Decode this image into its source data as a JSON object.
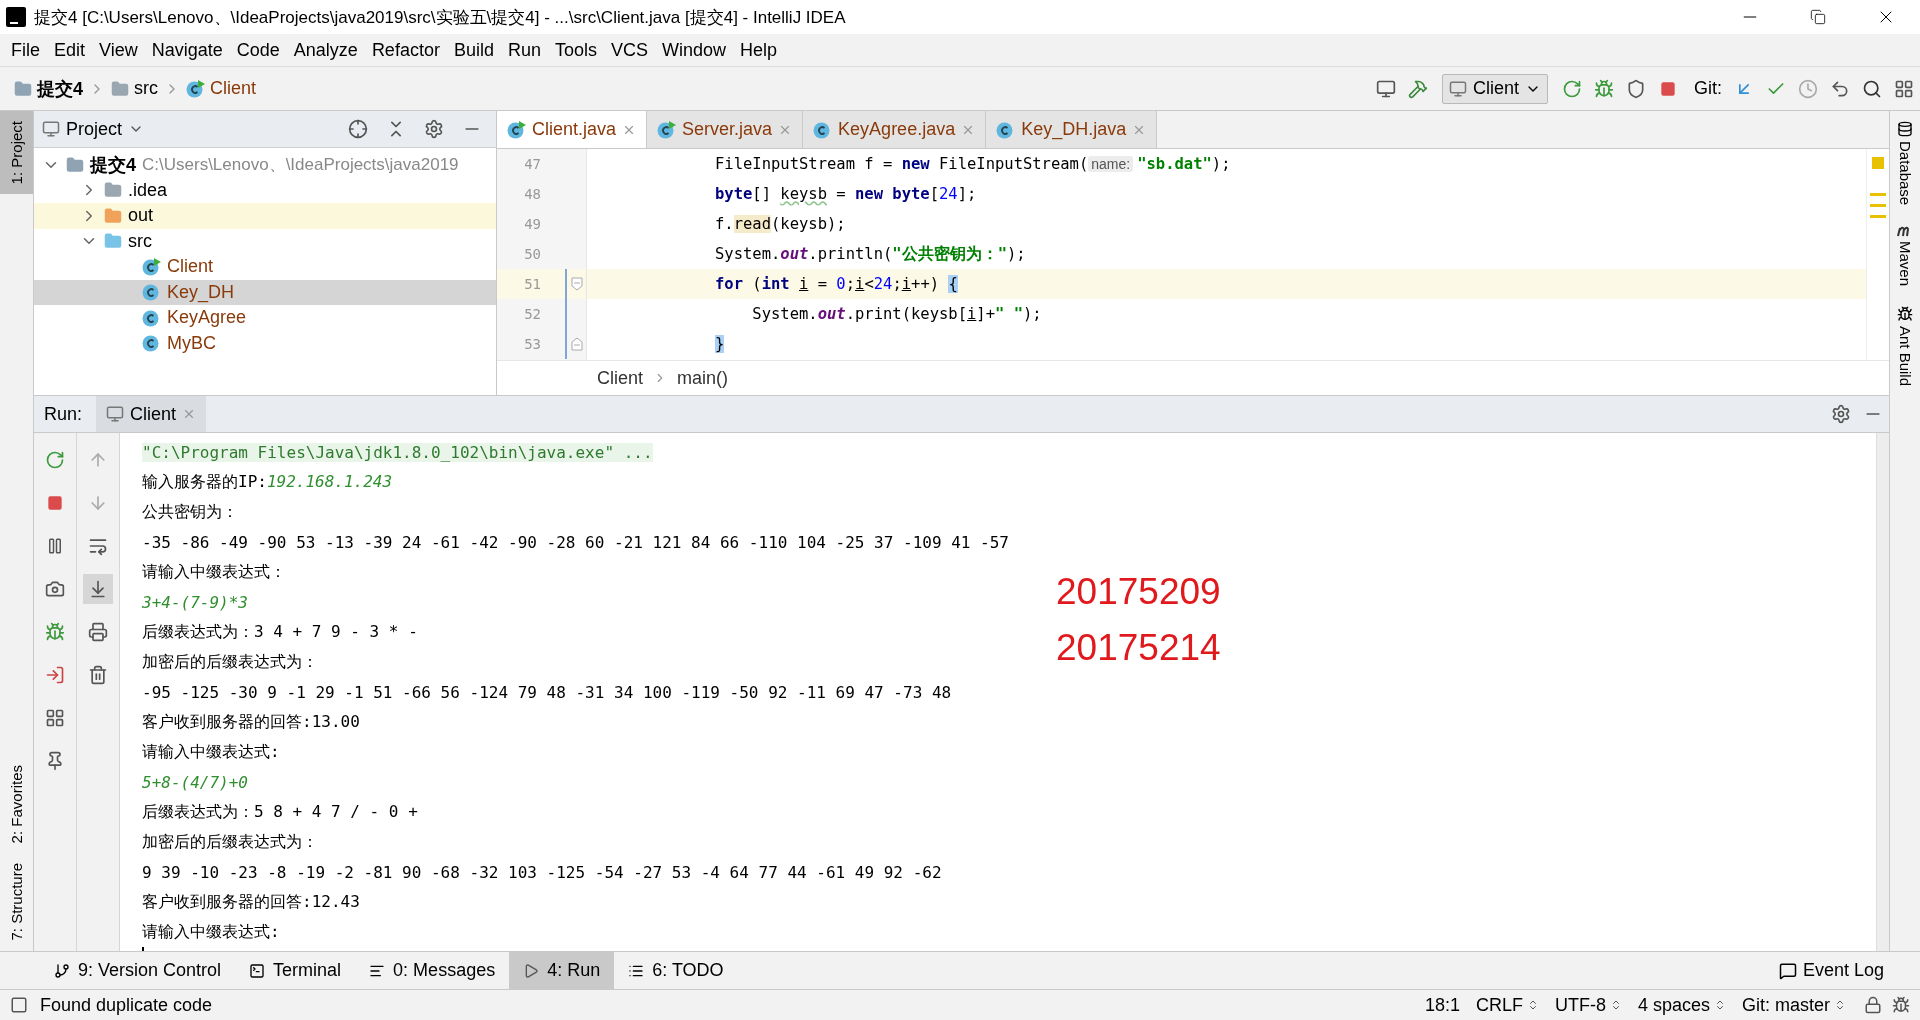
{
  "window": {
    "title": "提交4 [C:\\Users\\Lenovo、\\IdeaProjects\\java2019\\src\\实验五\\提交4] - ...\\src\\Client.java [提交4] - IntelliJ IDEA"
  },
  "menu": [
    "File",
    "Edit",
    "View",
    "Navigate",
    "Code",
    "Analyze",
    "Refactor",
    "Build",
    "Run",
    "Tools",
    "VCS",
    "Window",
    "Help"
  ],
  "breadcrumb": [
    {
      "label": "提交4",
      "kind": "module"
    },
    {
      "label": "src",
      "kind": "folder"
    },
    {
      "label": "Client",
      "kind": "runnable"
    }
  ],
  "toolbar": {
    "run_config": "Client",
    "git_label": "Git:"
  },
  "left_stripe": [
    {
      "label": "1: Project",
      "selected": true,
      "kind": "top"
    },
    {
      "label": "2: Favorites",
      "selected": false,
      "kind": "bottom"
    },
    {
      "label": "7: Structure",
      "selected": false,
      "kind": "bottom"
    }
  ],
  "right_stripe": [
    "Database",
    "Maven",
    "Ant Build"
  ],
  "project_panel": {
    "title": "Project",
    "tree": [
      {
        "label": "提交4",
        "path": "C:\\Users\\Lenovo、\\IdeaProjects\\java2019",
        "kind": "module",
        "expanded": true,
        "selected": false,
        "children": [
          {
            "label": ".idea",
            "kind": "folder",
            "expanded": false,
            "selected": false
          },
          {
            "label": "out",
            "kind": "excluded",
            "expanded": false,
            "selected": false
          },
          {
            "label": "src",
            "kind": "source",
            "expanded": true,
            "selected": false,
            "children": [
              {
                "label": "Client",
                "kind": "runnable",
                "selected": false
              },
              {
                "label": "Key_DH",
                "kind": "class",
                "selected": true
              },
              {
                "label": "KeyAgree",
                "kind": "class",
                "selected": false
              },
              {
                "label": "MyBC",
                "kind": "class",
                "selected": false
              }
            ]
          }
        ]
      }
    ]
  },
  "editor_tabs": [
    {
      "label": "Client.java",
      "kind": "runnable",
      "selected": true
    },
    {
      "label": "Server.java",
      "kind": "runnable",
      "selected": false
    },
    {
      "label": "KeyAgree.java",
      "kind": "class",
      "selected": false
    },
    {
      "label": "Key_DH.java",
      "kind": "class",
      "selected": false
    }
  ],
  "code_lines": [
    {
      "number": "47",
      "current": false,
      "changed": false,
      "segments": [
        {
          "kind": "plain",
          "text": "FileInputStream f = "
        },
        {
          "kind": "kw",
          "text": "new"
        },
        {
          "kind": "plain",
          "text": " FileInputStream("
        },
        {
          "kind": "hint",
          "text": "name:"
        },
        {
          "kind": "str",
          "text": "\"sb.dat\""
        },
        {
          "kind": "plain",
          "text": ");"
        }
      ]
    },
    {
      "number": "48",
      "current": false,
      "changed": false,
      "segments": [
        {
          "kind": "kw",
          "text": "byte"
        },
        {
          "kind": "plain",
          "text": "[] "
        },
        {
          "kind": "typo",
          "text": "keysb"
        },
        {
          "kind": "plain",
          "text": " = "
        },
        {
          "kind": "kw",
          "text": "new byte"
        },
        {
          "kind": "plain",
          "text": "["
        },
        {
          "kind": "num",
          "text": "24"
        },
        {
          "kind": "plain",
          "text": "];"
        }
      ]
    },
    {
      "number": "49",
      "current": false,
      "changed": false,
      "segments": [
        {
          "kind": "plain",
          "text": "f."
        },
        {
          "kind": "mark",
          "text": "read"
        },
        {
          "kind": "plain",
          "text": "(keysb);"
        }
      ]
    },
    {
      "number": "50",
      "current": false,
      "changed": false,
      "segments": [
        {
          "kind": "plain",
          "text": "System."
        },
        {
          "kind": "static",
          "text": "out"
        },
        {
          "kind": "plain",
          "text": ".println("
        },
        {
          "kind": "str",
          "text": "\"公共密钥为：\""
        },
        {
          "kind": "plain",
          "text": ");"
        }
      ]
    },
    {
      "number": "51",
      "current": true,
      "changed": true,
      "fold_start": true,
      "segments": [
        {
          "kind": "kw",
          "text": "for"
        },
        {
          "kind": "plain",
          "text": " ("
        },
        {
          "kind": "kw",
          "text": "int "
        },
        {
          "kind": "var",
          "text": "i"
        },
        {
          "kind": "plain",
          "text": " = "
        },
        {
          "kind": "num",
          "text": "0"
        },
        {
          "kind": "plain",
          "text": ";"
        },
        {
          "kind": "var",
          "text": "i"
        },
        {
          "kind": "plain",
          "text": "<"
        },
        {
          "kind": "num",
          "text": "24"
        },
        {
          "kind": "plain",
          "text": ";"
        },
        {
          "kind": "var",
          "text": "i"
        },
        {
          "kind": "plain",
          "text": "++) "
        },
        {
          "kind": "brace",
          "text": "{"
        }
      ]
    },
    {
      "number": "52",
      "current": false,
      "changed": true,
      "segments": [
        {
          "kind": "plain",
          "text": "    System."
        },
        {
          "kind": "static",
          "text": "out"
        },
        {
          "kind": "plain",
          "text": ".print(keysb["
        },
        {
          "kind": "var",
          "text": "i"
        },
        {
          "kind": "plain",
          "text": "]+"
        },
        {
          "kind": "str",
          "text": "\" \""
        },
        {
          "kind": "plain",
          "text": ");"
        }
      ]
    },
    {
      "number": "53",
      "current": false,
      "changed": true,
      "fold_end": true,
      "segments": [
        {
          "kind": "brace",
          "text": "}"
        }
      ]
    }
  ],
  "editor_breadcrumb": [
    "Client",
    "main()"
  ],
  "run_panel": {
    "label": "Run:",
    "tab": "Client",
    "cursor": true,
    "lines": [
      [
        {
          "kind": "command",
          "text": "\"C:\\Program Files\\Java\\jdk1.8.0_102\\bin\\java.exe\" ..."
        }
      ],
      [
        {
          "kind": "out",
          "text": "输入服务器的IP:"
        },
        {
          "kind": "input",
          "text": "192.168.1.243"
        }
      ],
      [
        {
          "kind": "out",
          "text": "公共密钥为："
        }
      ],
      [
        {
          "kind": "out",
          "text": "-35 -86 -49 -90 53 -13 -39 24 -61 -42 -90 -28 60 -21 121 84 66 -110 104 -25 37 -109 41 -57"
        }
      ],
      [
        {
          "kind": "out",
          "text": "请输入中缀表达式："
        }
      ],
      [
        {
          "kind": "input",
          "text": "3+4-(7-9)*3"
        }
      ],
      [
        {
          "kind": "out",
          "text": "后缀表达式为：3 4 + 7 9 - 3 * -"
        }
      ],
      [
        {
          "kind": "out",
          "text": "加密后的后缀表达式为："
        }
      ],
      [
        {
          "kind": "out",
          "text": "-95 -125 -30 9 -1 29 -1 51 -66 56 -124 79 48 -31 34 100 -119 -50 92 -11 69 47 -73 48"
        }
      ],
      [
        {
          "kind": "out",
          "text": "客户收到服务器的回答:13.00"
        }
      ],
      [
        {
          "kind": "out",
          "text": "请输入中缀表达式:"
        }
      ],
      [
        {
          "kind": "input",
          "text": "5+8-(4/7)+0"
        }
      ],
      [
        {
          "kind": "out",
          "text": "后缀表达式为：5 8 + 4 7 / - 0 +"
        }
      ],
      [
        {
          "kind": "out",
          "text": "加密后的后缀表达式为："
        }
      ],
      [
        {
          "kind": "out",
          "text": "9 39 -10 -23 -8 -19 -2 -81 90 -68 -32 103 -125 -54 -27 53 -4 64 77 44 -61 49 92 -62"
        }
      ],
      [
        {
          "kind": "out",
          "text": "客户收到服务器的回答:12.43"
        }
      ],
      [
        {
          "kind": "out",
          "text": "请输入中缀表达式:"
        }
      ]
    ]
  },
  "annotations": [
    "20175209",
    "20175214"
  ],
  "bottom_tabs": [
    {
      "label": "9: Version Control",
      "kind": "vcs",
      "selected": false
    },
    {
      "label": "Terminal",
      "kind": "terminal",
      "selected": false
    },
    {
      "label": "0: Messages",
      "kind": "messages",
      "selected": false
    },
    {
      "label": "4: Run",
      "kind": "run",
      "selected": true
    },
    {
      "label": "6: TODO",
      "kind": "todo",
      "selected": false
    }
  ],
  "event_log": "Event Log",
  "status": {
    "message": "Found duplicate code",
    "position": "18:1",
    "items": [
      "CRLF",
      "UTF-8",
      "4 spaces",
      "Git: master"
    ]
  }
}
